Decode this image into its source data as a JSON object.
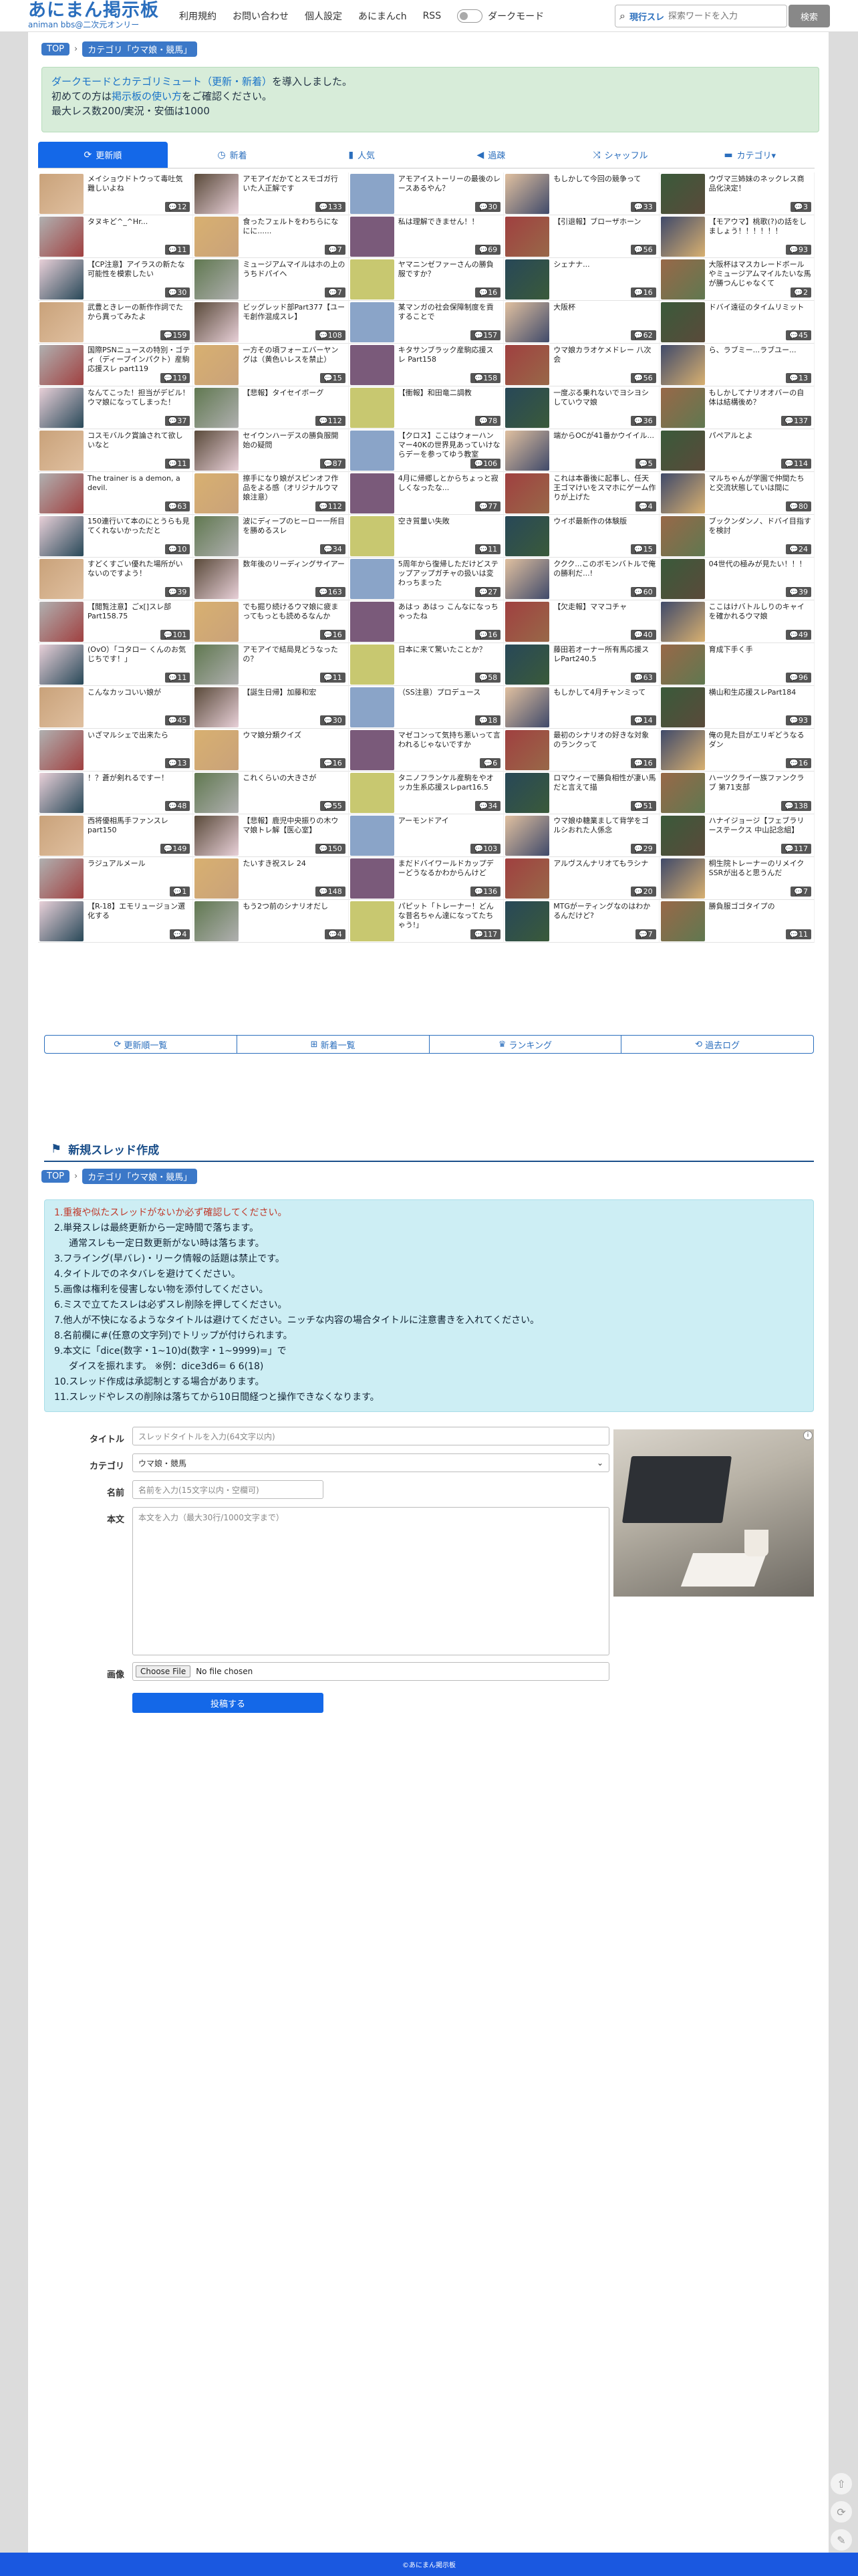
{
  "header": {
    "logo_title": "あにまん掲示板",
    "logo_sub": "animan bbs@二次元オンリー",
    "nav": [
      "利用規約",
      "お問い合わせ",
      "個人設定",
      "あにまんch",
      "RSS"
    ],
    "dark_mode_label": "ダークモード",
    "search_scope": "現行スレ",
    "search_placeholder": "探索ワードを入力",
    "search_button": "検索"
  },
  "breadcrumb": {
    "top": "TOP",
    "category": "カテゴリ「ウマ娘・競馬」"
  },
  "notice": {
    "line1_link": "ダークモードとカテゴリミュート（更新・新着）",
    "line1_rest": "を導入しました。",
    "line2_pre": "初めての方は",
    "line2_link": "掲示板の使い方",
    "line2_post": "をご確認ください。",
    "line3": "最大レス数200/実況・安価は1000"
  },
  "tabs": [
    {
      "icon": "refresh-icon",
      "glyph": "⟳",
      "label": "更新順"
    },
    {
      "icon": "clock-icon",
      "glyph": "◷",
      "label": "新着"
    },
    {
      "icon": "bar-chart-icon",
      "glyph": "▮",
      "label": "人気"
    },
    {
      "icon": "speaker-icon",
      "glyph": "◀",
      "label": "過疎"
    },
    {
      "icon": "shuffle-icon",
      "glyph": "⤨",
      "label": "シャッフル"
    },
    {
      "icon": "folder-icon",
      "glyph": "▬",
      "label": "カテゴリ▾"
    }
  ],
  "threads": [
    {
      "t": "メイショウドトウって毒吐気難しいよね",
      "n": "12"
    },
    {
      "t": "アモアイだかてとスモゴガ行いた人正解です",
      "n": "133"
    },
    {
      "t": "アモアイストーリーの最後のレースあるやん？",
      "n": "30"
    },
    {
      "t": "もしかして今回の競争って",
      "n": "33"
    },
    {
      "t": "ウヴマ三姉妹のネックレス商品化決定！",
      "n": "3"
    },
    {
      "t": "タヌキど^_^Hr...",
      "n": "11"
    },
    {
      "t": "食ったフェルトをわちらになにに......",
      "n": "7"
    },
    {
      "t": "私は理解できません！！",
      "n": "69"
    },
    {
      "t": "【引退報】ブローザホーン",
      "n": "56"
    },
    {
      "t": "【モアウマ】桃歌(?)の話をしましょう！！！！！！",
      "n": "93"
    },
    {
      "t": "【CP注意】アイラスの新たな可能性を模索したい",
      "n": "30"
    },
    {
      "t": "ミュージアムマイルはホの上のうちドパイヘ",
      "n": "7"
    },
    {
      "t": "ヤマニンゼファーさんの勝負服ですか？",
      "n": "16"
    },
    {
      "t": "シェナナ...",
      "n": "16"
    },
    {
      "t": "大阪杯はマスカレードボールやミュージアムマイルたいな馬が勝つんじゃなくて",
      "n": "2"
    },
    {
      "t": "武豊ときレーの新作作詞でたから異ってみたよ",
      "n": "159"
    },
    {
      "t": "ビッグレッド部Part377【ユーモ創作混成スレ】",
      "n": "108"
    },
    {
      "t": "某マンガの社会保障制度を貢することで",
      "n": "157"
    },
    {
      "t": "大阪杯",
      "n": "62"
    },
    {
      "t": "ドバイ遠征のタイムリミット",
      "n": "45"
    },
    {
      "t": "国際PSNニュースの特別・ゴティ（ディープインパクト）産駒応援スレ part119",
      "n": "119"
    },
    {
      "t": "一方その頃フォーエバーヤングは（黄色いレスを禁止）",
      "n": "15"
    },
    {
      "t": "キタサンブラック産駒応援スレ Part158",
      "n": "158"
    },
    {
      "t": "ウマ娘カラオケメドレー 八次会",
      "n": "56"
    },
    {
      "t": "ら、ラブミー...ラブユー...",
      "n": "13"
    },
    {
      "t": "なんてこった！担当がデビル！ ウマ娘になってしまった！",
      "n": "37"
    },
    {
      "t": "【悲報】タイセイボーグ",
      "n": "112"
    },
    {
      "t": "【衝報】和田竜二調教",
      "n": "78"
    },
    {
      "t": "一度ぷる乗れないでヨシヨシしていウマ娘",
      "n": "36"
    },
    {
      "t": "もしかしてナリオオバーの自体は結構後め？",
      "n": "137"
    },
    {
      "t": "コスモバルク賞論されて欲しいなと",
      "n": "11"
    },
    {
      "t": "セイウンハーデスの勝負服開始の疑問",
      "n": "87"
    },
    {
      "t": "【クロス】ここはウォーハンマー40Kの世界見あっていけならデーを参ってゆう教室",
      "n": "106"
    },
    {
      "t": "端からOCが41番かウイイル...",
      "n": "5"
    },
    {
      "t": "パペアルとよ",
      "n": "114"
    },
    {
      "t": "The trainer is a demon, a devil.",
      "n": "63"
    },
    {
      "t": "擦手になり娘がスピンオフ作品をよる感（オリジナルウマ娘注意）",
      "n": "112"
    },
    {
      "t": "4月に帰郷しとからちょっと寂しくなったな...",
      "n": "77"
    },
    {
      "t": "これは本番後に起事し、任天王ゴマけいをスマホにゲーム作りが上げた",
      "n": "4"
    },
    {
      "t": "マルちゃんが学園で仲間たちと交流状態していは間に",
      "n": "80"
    },
    {
      "t": "150連行いて本のにとうらも見てくれないかっただと",
      "n": "10"
    },
    {
      "t": "波にディープのヒーロー一所目を勝めるスレ",
      "n": "34"
    },
    {
      "t": "空き質量い失敗",
      "n": "11"
    },
    {
      "t": "ウイポ最新作の体験版",
      "n": "15"
    },
    {
      "t": "ブックンダンノ、ドバイ目指すを検討",
      "n": "24"
    },
    {
      "t": "すどくすごい優れた場所がいないのですよう！",
      "n": "39"
    },
    {
      "t": "数年後のリーディングサイアー",
      "n": "163"
    },
    {
      "t": "5周年から復帰しただけどステップアップガチャの扱いは変わっちまった",
      "n": "27"
    },
    {
      "t": "ククク...このボモンバトルで俺の勝利だ...!",
      "n": "60"
    },
    {
      "t": "04世代の極みが見たい！！！",
      "n": "39"
    },
    {
      "t": "【閲覧注意】ごx[]スレ部Part158.75",
      "n": "101"
    },
    {
      "t": "でも掘り続けるウマ娘に疲まってもっとも読めるなんか",
      "n": "16"
    },
    {
      "t": "あはっ あはっ こんなになっちゃったね",
      "n": "16"
    },
    {
      "t": "【欠走報】ママコチャ",
      "n": "40"
    },
    {
      "t": "ここはけバトルしりのキャイを確かれるウマ娘",
      "n": "49"
    },
    {
      "t": "(OvO）「コタロー くんのお気じちです！」",
      "n": "11"
    },
    {
      "t": "アモアイで結局見どうなったの？",
      "n": "11"
    },
    {
      "t": "日本に来て驚いたことか？",
      "n": "58"
    },
    {
      "t": "藤田若オーナー所有馬応援スレPart240.5",
      "n": "63"
    },
    {
      "t": "育成下手く手",
      "n": "96"
    },
    {
      "t": "こんなカッコいい娘が",
      "n": "45"
    },
    {
      "t": "【誕生日帰】加藤和宏",
      "n": "30"
    },
    {
      "t": "（SS注意）プロデュース",
      "n": "18"
    },
    {
      "t": "もしかして4月チャンミって",
      "n": "14"
    },
    {
      "t": "横山和生応援スレPart184",
      "n": "93"
    },
    {
      "t": "いざマルシェで出来たら",
      "n": "13"
    },
    {
      "t": "ウマ娘分類クイズ",
      "n": "16"
    },
    {
      "t": "マゼコンって気持ち悪いって言われるじゃないですか",
      "n": "6"
    },
    {
      "t": "最初のシナリオの好きな対象のランクって",
      "n": "16"
    },
    {
      "t": "俺の見た目がエリギどうなるダン",
      "n": "16"
    },
    {
      "t": "！？蒼が剣れるですー！",
      "n": "48"
    },
    {
      "t": "これくらいの大きさが",
      "n": "55"
    },
    {
      "t": "タニノフランケル産駒をやオッカ生系応援スレpart16.5",
      "n": "34"
    },
    {
      "t": "ロマウィーで勝負相性が凄い馬だと言えて描",
      "n": "51"
    },
    {
      "t": "ハーツクライ一族ファンクラブ 第71支部",
      "n": "138"
    },
    {
      "t": "西将優相馬手ファンスレpart150",
      "n": "149"
    },
    {
      "t": "【悲報】鹿児中央振りの木ウマ娘トレ解【医心室】",
      "n": "150"
    },
    {
      "t": "アーモンドアイ",
      "n": "103"
    },
    {
      "t": "ウマ娘ゆ糖業まして背学をゴルシおれた人係念",
      "n": "29"
    },
    {
      "t": "ハナイジョージ【フェブラリーステークス 中山記念組】",
      "n": "117"
    },
    {
      "t": "ラジュアルメール",
      "n": "1"
    },
    {
      "t": "たいすき祝スレ 24",
      "n": "148"
    },
    {
      "t": "まだドバイワールドカップデーどうなるかわからんけど",
      "n": "136"
    },
    {
      "t": "アルヴスんナリオてもラシナ",
      "n": "20"
    },
    {
      "t": "桐生院トレーナーのリメイクSSRが出ると思うんだ",
      "n": "7"
    },
    {
      "t": "【R-18】エモリュージョン選化する",
      "n": "4"
    },
    {
      "t": "もう2つ前のシナリオだし",
      "n": "4"
    },
    {
      "t": "パピット「トレーナー！どんな昔名ちゃん達になってたちゃう!」",
      "n": "117"
    },
    {
      "t": "MTGがーティングなのはわかるんだけど?",
      "n": "7"
    },
    {
      "t": "勝負服ゴゴタイプの",
      "n": "11"
    }
  ],
  "links": [
    {
      "icon": "refresh-icon",
      "glyph": "⟳",
      "label": "更新順一覧"
    },
    {
      "icon": "new-icon",
      "glyph": "⊞",
      "label": "新着一覧"
    },
    {
      "icon": "ranking-icon",
      "glyph": "♛",
      "label": "ランキング"
    },
    {
      "icon": "history-icon",
      "glyph": "⟲",
      "label": "過去ログ"
    }
  ],
  "new_thread": {
    "title": "新規スレッド作成",
    "rules": [
      "1.重複や似たスレッドがないか必ず確認してください。",
      "2.単発スレは最終更新から一定時間で落ちます。",
      "通常スレも一定日数更新がない時は落ちます。",
      "3.フライング(早バレ)・リーク情報の話題は禁止です。",
      "4.タイトルでのネタバレを避けてください。",
      "5.画像は権利を侵害しない物を添付してください。",
      "6.ミスで立てたスレは必ずスレ削除を押してください。",
      "7.他人が不快になるようなタイトルは避けてください。ニッチな内容の場合タイトルに注意書きを入れてください。",
      "8.名前欄に#(任意の文字列)でトリップが付けられます。",
      "9.本文に「dice(数字・1~10)d(数字・1~9999)=」で",
      "ダイスを振れます。 ※例：dice3d6= 6 6(18)",
      "10.スレッド作成は承認制とする場合があります。",
      "11.スレッドやレスの削除は落ちてから10日間経つと操作できなくなります。"
    ],
    "form": {
      "title_label": "タイトル",
      "title_placeholder": "スレッドタイトルを入力(64文字以内)",
      "category_label": "カテゴリ",
      "category_value": "ウマ娘・競馬",
      "name_label": "名前",
      "name_placeholder": "名前を入力(15文字以内・空欄可)",
      "body_label": "本文",
      "body_placeholder": "本文を入力（最大30行/1000文字まで）",
      "image_label": "画像",
      "file_button": "Choose File",
      "file_status": "No file chosen",
      "submit": "投稿する"
    }
  },
  "footer": "©あにまん掲示板",
  "colors": {
    "accent": "#1468e8",
    "brand": "#2a6ebd",
    "notice_bg": "#d7ecd9",
    "rules_bg": "#cdeef4"
  }
}
